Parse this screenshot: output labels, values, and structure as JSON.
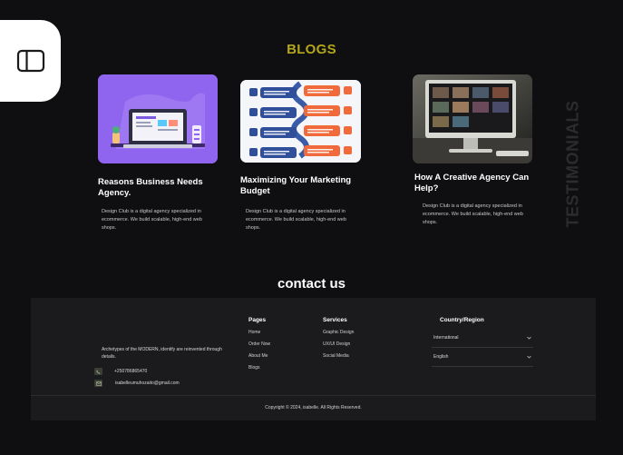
{
  "blogs": {
    "title": "BLOGS",
    "cards": [
      {
        "title": "Reasons Business Needs Agency.",
        "text": "Design Club is a digital agency specialized in ecommerce. We build scalable, high-end web shops."
      },
      {
        "title": "Maximizing Your Marketing Budget",
        "text": "Design Club is a digital agency specialized in ecommerce. We build scalable, high-end web shops."
      },
      {
        "title": "How A Creative Agency Can Help?",
        "text": "Design Club is a digital agency specialized in ecommerce. We build scalable, high-end web shops."
      }
    ]
  },
  "testimonials": {
    "label": "TESTIMONIALS"
  },
  "contact": {
    "title": "contact us"
  },
  "footer": {
    "about": "Archetypes of the MODERN, identify are reinvented through details.",
    "phone": "+250786865470",
    "email": "isabelleumuhozaito@gmail.com",
    "pages": {
      "title": "Pages",
      "items": [
        "Home",
        "Order Now",
        "About Me",
        "Blogs"
      ]
    },
    "services": {
      "title": "Services",
      "items": [
        "Graphic Design",
        "UX/UI Design",
        "Social Media"
      ]
    },
    "region": {
      "title": "Country/Region",
      "country": "International",
      "language": "English"
    },
    "copyright": "Copyright © 2024, isabelle. All Rights Reserved."
  },
  "colors": {
    "background": "#0f0f11",
    "accent_title": "#b3a61a",
    "footer_bg": "#1b1b1d"
  },
  "icons": [
    "sidebar-toggle-icon",
    "phone-icon",
    "email-icon",
    "chevron-down-icon"
  ]
}
